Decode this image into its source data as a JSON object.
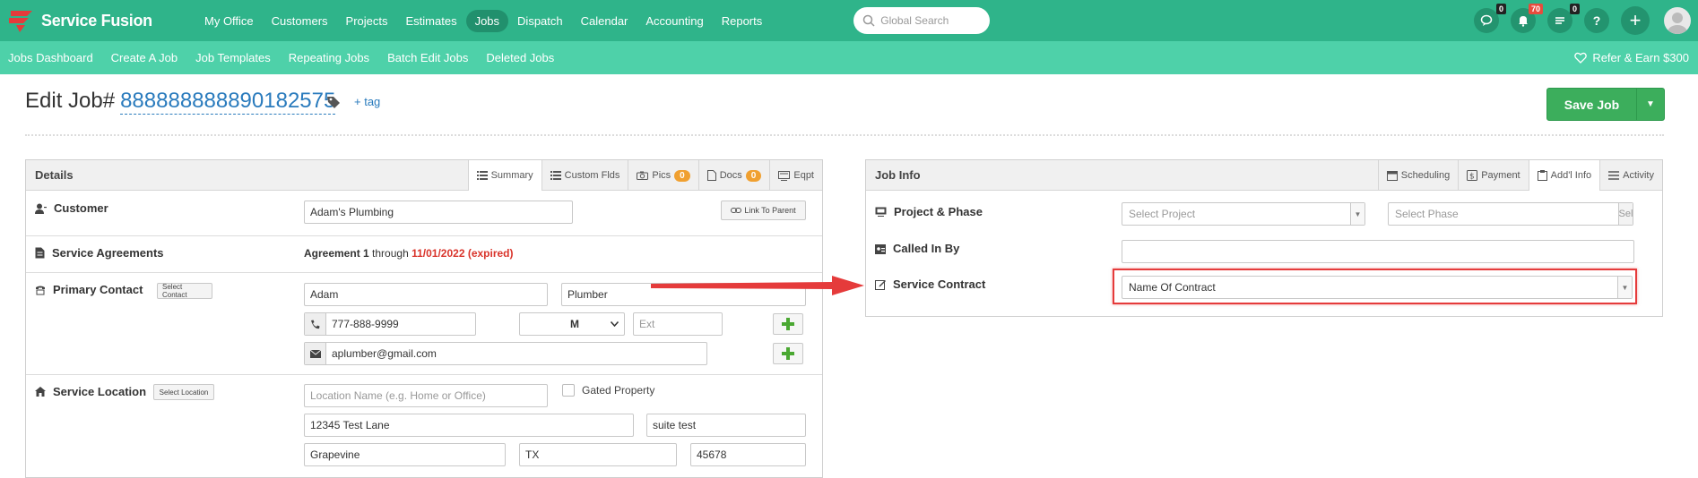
{
  "brand": {
    "name": "Service Fusion",
    "primary": "#2fb48a",
    "secondary": "#4ed1a9",
    "accent": "#e53b3b"
  },
  "nav": {
    "items": [
      {
        "label": "My Office"
      },
      {
        "label": "Customers"
      },
      {
        "label": "Projects"
      },
      {
        "label": "Estimates"
      },
      {
        "label": "Jobs",
        "active": true
      },
      {
        "label": "Dispatch"
      },
      {
        "label": "Calendar"
      },
      {
        "label": "Accounting"
      },
      {
        "label": "Reports"
      }
    ],
    "search_placeholder": "Global Search",
    "badges": {
      "chat": "0",
      "notifications": "70",
      "tasks": "0"
    },
    "help": "?",
    "add": "+"
  },
  "subnav": {
    "items": [
      {
        "label": "Jobs Dashboard"
      },
      {
        "label": "Create A Job"
      },
      {
        "label": "Job Templates"
      },
      {
        "label": "Repeating Jobs"
      },
      {
        "label": "Batch Edit Jobs"
      },
      {
        "label": "Deleted Jobs"
      }
    ],
    "refer": "Refer & Earn $300"
  },
  "header": {
    "title": "Edit Job#",
    "job_number": "888888888890182575",
    "tag_link": "+ tag",
    "save_label": "Save Job"
  },
  "details": {
    "title": "Details",
    "tabs": [
      {
        "label": "Summary",
        "icon": "list-icon"
      },
      {
        "label": "Custom Flds",
        "icon": "list-icon"
      },
      {
        "label": "Pics",
        "icon": "camera-icon",
        "count": "0"
      },
      {
        "label": "Docs",
        "icon": "document-icon",
        "count": "0"
      },
      {
        "label": "Eqpt",
        "icon": "equipment-icon"
      }
    ],
    "customer": {
      "label": "Customer",
      "value": "Adam's Plumbing",
      "link_parent": "Link To Parent"
    },
    "agreements": {
      "label": "Service Agreements",
      "agreement": "Agreement 1",
      "through": "through",
      "date_status": "11/01/2022 (expired)"
    },
    "contact": {
      "label": "Primary Contact",
      "select_button": "Select Contact",
      "first_name": "Adam",
      "last_name": "Plumber",
      "phone": "777-888-9999",
      "phone_type": "M",
      "ext_placeholder": "Ext",
      "email": "aplumber@gmail.com"
    },
    "location": {
      "label": "Service Location",
      "select_button": "Select Location",
      "name_placeholder": "Location Name (e.g. Home or Office)",
      "gated_label": "Gated Property",
      "street": "12345 Test Lane",
      "suite": "suite test",
      "city": "Grapevine",
      "state": "TX",
      "zip": "45678"
    }
  },
  "jobinfo": {
    "title": "Job Info",
    "tabs": [
      {
        "label": "Scheduling",
        "icon": "calendar-icon"
      },
      {
        "label": "Payment",
        "icon": "payment-icon"
      },
      {
        "label": "Add'l Info",
        "icon": "clipboard-icon",
        "active": true
      },
      {
        "label": "Activity",
        "icon": "list-icon"
      }
    ],
    "project_phase": {
      "label": "Project & Phase",
      "project_placeholder": "Select Project",
      "phase_placeholder": "Select Phase",
      "phase_button": "Sel"
    },
    "called_in_by": {
      "label": "Called In By",
      "value": ""
    },
    "service_contract": {
      "label": "Service Contract",
      "value": "Name Of Contract"
    }
  }
}
